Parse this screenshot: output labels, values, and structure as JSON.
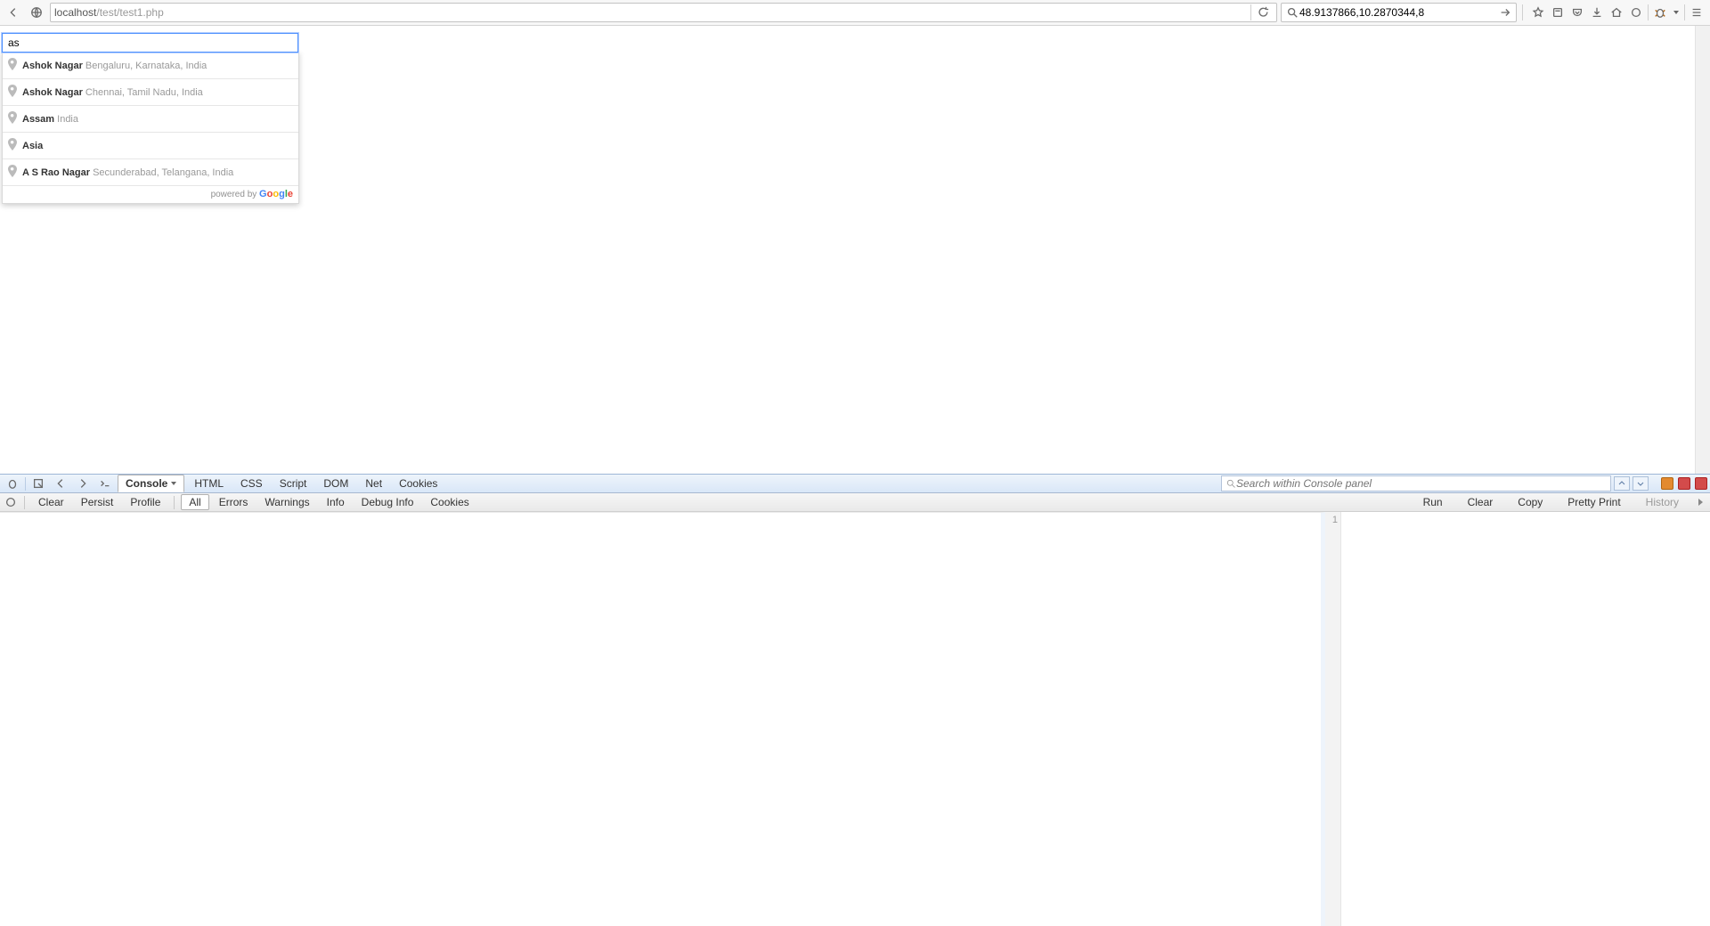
{
  "browser": {
    "url_host": "localhost",
    "url_path": "/test/test1.php",
    "search_value": "48.9137866,10.2870344,8"
  },
  "page": {
    "input_value": "as",
    "suggestions": [
      {
        "main": "Ashok Nagar",
        "secondary": "Bengaluru, Karnataka, India"
      },
      {
        "main": "Ashok Nagar",
        "secondary": "Chennai, Tamil Nadu, India"
      },
      {
        "main": "Assam",
        "secondary": "India"
      },
      {
        "main": "Asia",
        "secondary": ""
      },
      {
        "main": "A S Rao Nagar",
        "secondary": "Secunderabad, Telangana, India"
      }
    ],
    "powered_by": "powered by "
  },
  "firebug": {
    "tabs": [
      "Console",
      "HTML",
      "CSS",
      "Script",
      "DOM",
      "Net",
      "Cookies"
    ],
    "active_tab": "Console",
    "search_placeholder": "Search within Console panel",
    "sub": {
      "buttons": [
        "Clear",
        "Persist",
        "Profile"
      ],
      "filters": [
        "All",
        "Errors",
        "Warnings",
        "Info",
        "Debug Info",
        "Cookies"
      ],
      "active_filter": "All",
      "right": [
        "Run",
        "Clear",
        "Copy",
        "Pretty Print",
        "History"
      ]
    },
    "gutter_line": "1"
  }
}
